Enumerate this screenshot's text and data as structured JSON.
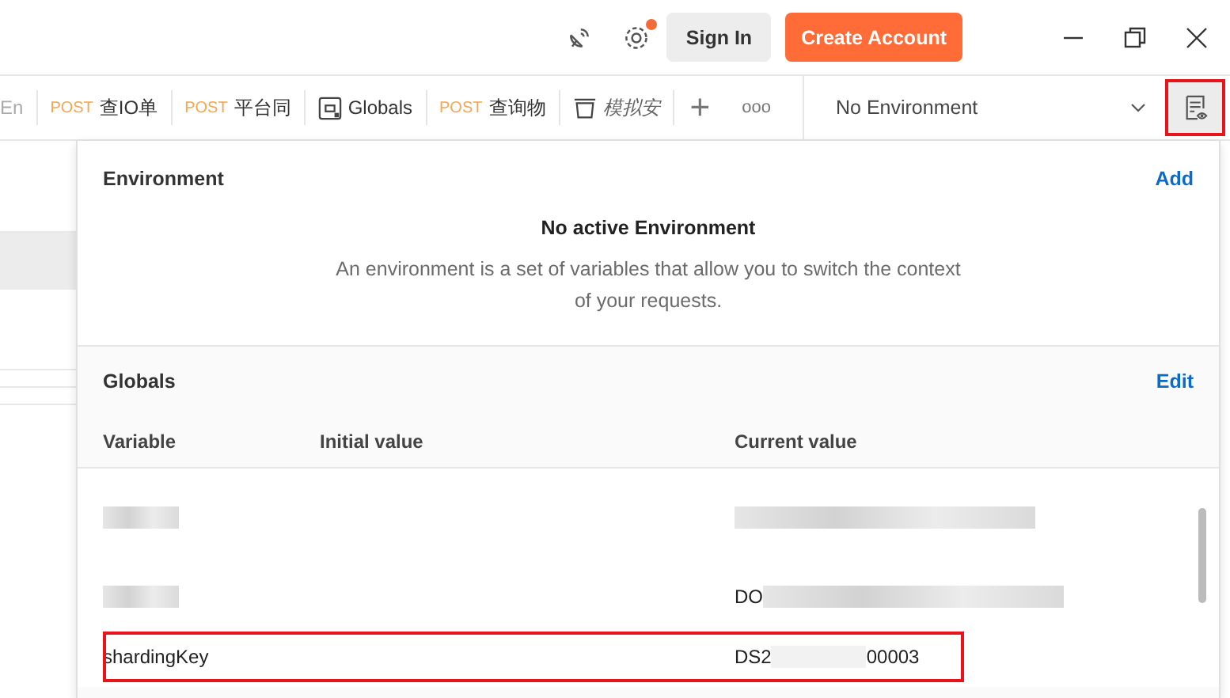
{
  "header": {
    "sign_in": "Sign In",
    "create_account": "Create Account",
    "settings_notification": true
  },
  "tabs": [
    {
      "kind": "partial",
      "label": "En"
    },
    {
      "kind": "request",
      "method": "POST",
      "label": "查IO单"
    },
    {
      "kind": "request",
      "method": "POST",
      "label": "平台同"
    },
    {
      "kind": "globals",
      "label": "Globals"
    },
    {
      "kind": "request",
      "method": "POST",
      "label": "查询物"
    },
    {
      "kind": "collection",
      "label": "模拟安"
    }
  ],
  "new_tab": "+",
  "more": "ooo",
  "environment_selector": {
    "value": "No Environment",
    "quick_look_highlighted": true
  },
  "environment_panel": {
    "title": "Environment",
    "action": "Add",
    "empty_title": "No active Environment",
    "empty_text": "An environment is a set of variables that allow you to switch the context of your requests."
  },
  "globals_panel": {
    "title": "Globals",
    "action": "Edit",
    "columns": [
      "Variable",
      "Initial value",
      "Current value"
    ],
    "rows": [
      {
        "variable": null,
        "current": null,
        "highlighted": false
      },
      {
        "variable": null,
        "current": "DO",
        "highlighted": false
      },
      {
        "variable": "shardingKey",
        "current": "DS2",
        "current_tail": "00003",
        "highlighted": true
      }
    ]
  }
}
